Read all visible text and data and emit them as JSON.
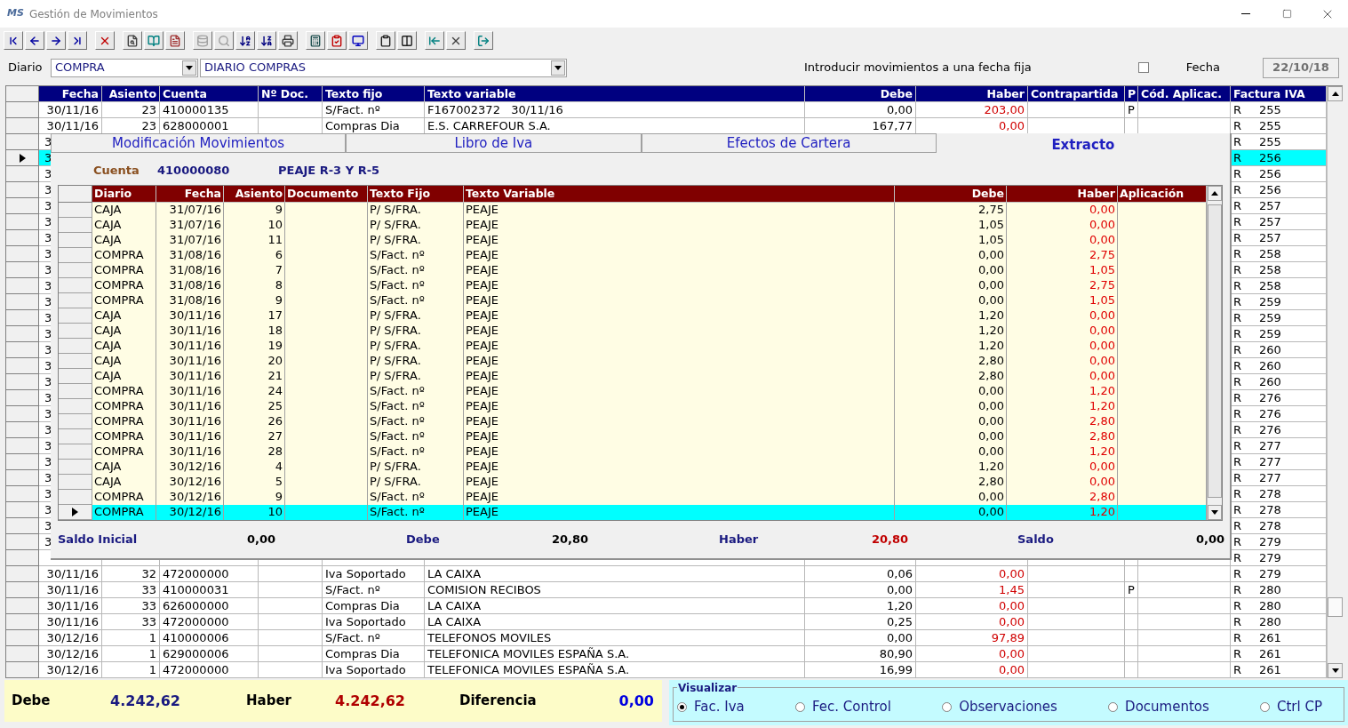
{
  "window": {
    "title": "Gestión de Movimientos",
    "logo": "MS"
  },
  "diario": {
    "label": "Diario",
    "code": "COMPRA",
    "name": "DIARIO COMPRAS"
  },
  "fixed_date": {
    "label": "Introducir movimientos a una fecha fija",
    "checked": false,
    "date_label": "Fecha",
    "date": "22/10/18"
  },
  "table": {
    "columns": [
      "Fecha",
      "Asiento",
      "Cuenta",
      "Nº Doc.",
      "Texto fijo",
      "Texto variable",
      "Debe",
      "Haber",
      "Contrapartida",
      "P",
      "Cód. Aplicac.",
      "Factura IVA"
    ],
    "rows": [
      {
        "selected": false,
        "fecha": "30/11/16",
        "asiento": "23",
        "cuenta": "410000135",
        "texto_fijo": "S/Fact. nº",
        "texto_variable": "F167002372   30/11/16",
        "debe": "0,00",
        "haber": "203,00",
        "p": "P",
        "tipo": "R",
        "factura": "255"
      },
      {
        "selected": false,
        "fecha": "30/11/16",
        "asiento": "23",
        "cuenta": "628000001",
        "texto_fijo": "Compras Dia",
        "texto_variable": "E.S. CARREFOUR S.A.",
        "debe": "167,77",
        "haber": "0,00",
        "tipo": "R",
        "factura": "255"
      },
      {
        "selected": false,
        "fecha": "3",
        "tipo": "R",
        "factura": "255"
      },
      {
        "selected": true,
        "fecha": "3",
        "tipo": "R",
        "factura": "256"
      },
      {
        "selected": false,
        "fecha": "3",
        "tipo": "R",
        "factura": "256"
      },
      {
        "selected": false,
        "fecha": "3",
        "tipo": "R",
        "factura": "256"
      },
      {
        "selected": false,
        "fecha": "3",
        "tipo": "R",
        "factura": "257"
      },
      {
        "selected": false,
        "fecha": "3",
        "tipo": "R",
        "factura": "257"
      },
      {
        "selected": false,
        "fecha": "3",
        "tipo": "R",
        "factura": "257"
      },
      {
        "selected": false,
        "fecha": "3",
        "tipo": "R",
        "factura": "258"
      },
      {
        "selected": false,
        "fecha": "3",
        "tipo": "R",
        "factura": "258"
      },
      {
        "selected": false,
        "fecha": "3",
        "tipo": "R",
        "factura": "258"
      },
      {
        "selected": false,
        "fecha": "3",
        "tipo": "R",
        "factura": "259"
      },
      {
        "selected": false,
        "fecha": "3",
        "tipo": "R",
        "factura": "259"
      },
      {
        "selected": false,
        "fecha": "3",
        "tipo": "R",
        "factura": "259"
      },
      {
        "selected": false,
        "fecha": "3",
        "tipo": "R",
        "factura": "260"
      },
      {
        "selected": false,
        "fecha": "3",
        "tipo": "R",
        "factura": "260"
      },
      {
        "selected": false,
        "fecha": "3",
        "tipo": "R",
        "factura": "260"
      },
      {
        "selected": false,
        "fecha": "3",
        "tipo": "R",
        "factura": "276"
      },
      {
        "selected": false,
        "fecha": "3",
        "tipo": "R",
        "factura": "276"
      },
      {
        "selected": false,
        "fecha": "3",
        "tipo": "R",
        "factura": "276"
      },
      {
        "selected": false,
        "fecha": "3",
        "tipo": "R",
        "factura": "277"
      },
      {
        "selected": false,
        "fecha": "3",
        "tipo": "R",
        "factura": "277"
      },
      {
        "selected": false,
        "fecha": "3",
        "tipo": "R",
        "factura": "277"
      },
      {
        "selected": false,
        "fecha": "3",
        "tipo": "R",
        "factura": "278"
      },
      {
        "selected": false,
        "fecha": "3",
        "tipo": "R",
        "factura": "278"
      },
      {
        "selected": false,
        "fecha": "3",
        "tipo": "R",
        "factura": "278"
      },
      {
        "selected": false,
        "fecha": "3",
        "tipo": "R",
        "factura": "279"
      },
      {
        "selected": false,
        "tipo": "R",
        "factura": "279"
      },
      {
        "selected": false,
        "fecha": "30/11/16",
        "asiento": "32",
        "cuenta": "472000000",
        "texto_fijo": "Iva Soportado",
        "texto_variable": "LA CAIXA",
        "debe": "0,06",
        "haber": "0,00",
        "tipo": "R",
        "factura": "279"
      },
      {
        "selected": false,
        "fecha": "30/11/16",
        "asiento": "33",
        "cuenta": "410000031",
        "texto_fijo": "S/Fact. nº",
        "texto_variable": "COMISION RECIBOS",
        "debe": "0,00",
        "haber": "1,45",
        "p": "P",
        "tipo": "R",
        "factura": "280"
      },
      {
        "selected": false,
        "fecha": "30/11/16",
        "asiento": "33",
        "cuenta": "626000000",
        "texto_fijo": "Compras Dia",
        "texto_variable": "LA CAIXA",
        "debe": "1,20",
        "haber": "0,00",
        "tipo": "R",
        "factura": "280"
      },
      {
        "selected": false,
        "fecha": "30/11/16",
        "asiento": "33",
        "cuenta": "472000000",
        "texto_fijo": "Iva Soportado",
        "texto_variable": "LA CAIXA",
        "debe": "0,25",
        "haber": "0,00",
        "tipo": "R",
        "factura": "280"
      },
      {
        "selected": false,
        "fecha": "30/12/16",
        "asiento": "1",
        "cuenta": "410000006",
        "texto_fijo": "S/Fact. nº",
        "texto_variable": "TELEFONOS MOVILES",
        "debe": "0,00",
        "haber": "97,89",
        "tipo": "R",
        "factura": "261"
      },
      {
        "selected": false,
        "fecha": "30/12/16",
        "asiento": "1",
        "cuenta": "629000006",
        "texto_fijo": "Compras Dia",
        "texto_variable": "TELEFONICA MOVILES ESPAÑA S.A.",
        "debe": "80,90",
        "haber": "0,00",
        "tipo": "R",
        "factura": "261"
      },
      {
        "selected": false,
        "fecha": "30/12/16",
        "asiento": "1",
        "cuenta": "472000000",
        "texto_fijo": "Iva Soportado",
        "texto_variable": "TELEFONICA MOVILES ESPAÑA S.A.",
        "debe": "16,99",
        "haber": "0,00",
        "tipo": "R",
        "factura": "261"
      }
    ]
  },
  "popup": {
    "tabs": [
      {
        "label": "Modificación Movimientos",
        "selected": false
      },
      {
        "label": "Libro de Iva",
        "selected": false
      },
      {
        "label": "Efectos de Cartera",
        "selected": false
      },
      {
        "label": "Extracto",
        "selected": true
      }
    ],
    "account": {
      "label": "Cuenta",
      "number": "410000080",
      "name": "PEAJE R-3 Y R-5"
    },
    "extract": {
      "columns": [
        "Diario",
        "Fecha",
        "Asiento",
        "Documento",
        "Texto Fijo",
        "Texto Variable",
        "Debe",
        "Haber",
        "Aplicación"
      ],
      "rows": [
        {
          "selected": false,
          "diario": "CAJA",
          "fecha": "31/07/16",
          "asiento": "9",
          "texto_fijo": "P/ S/FRA.",
          "texto_variable": "PEAJE",
          "debe": "2,75",
          "haber": "0,00"
        },
        {
          "selected": false,
          "diario": "CAJA",
          "fecha": "31/07/16",
          "asiento": "10",
          "texto_fijo": "P/ S/FRA.",
          "texto_variable": "PEAJE",
          "debe": "1,05",
          "haber": "0,00"
        },
        {
          "selected": false,
          "diario": "CAJA",
          "fecha": "31/07/16",
          "asiento": "11",
          "texto_fijo": "P/ S/FRA.",
          "texto_variable": "PEAJE",
          "debe": "1,05",
          "haber": "0,00"
        },
        {
          "selected": false,
          "diario": "COMPRA",
          "fecha": "31/08/16",
          "asiento": "6",
          "texto_fijo": "S/Fact. nº",
          "texto_variable": "PEAJE",
          "debe": "0,00",
          "haber": "2,75"
        },
        {
          "selected": false,
          "diario": "COMPRA",
          "fecha": "31/08/16",
          "asiento": "7",
          "texto_fijo": "S/Fact. nº",
          "texto_variable": "PEAJE",
          "debe": "0,00",
          "haber": "1,05"
        },
        {
          "selected": false,
          "diario": "COMPRA",
          "fecha": "31/08/16",
          "asiento": "8",
          "texto_fijo": "S/Fact. nº",
          "texto_variable": "PEAJE",
          "debe": "0,00",
          "haber": "2,75"
        },
        {
          "selected": false,
          "diario": "COMPRA",
          "fecha": "31/08/16",
          "asiento": "9",
          "texto_fijo": "S/Fact. nº",
          "texto_variable": "PEAJE",
          "debe": "0,00",
          "haber": "1,05"
        },
        {
          "selected": false,
          "diario": "CAJA",
          "fecha": "30/11/16",
          "asiento": "17",
          "texto_fijo": "P/ S/FRA.",
          "texto_variable": "PEAJE",
          "debe": "1,20",
          "haber": "0,00"
        },
        {
          "selected": false,
          "diario": "CAJA",
          "fecha": "30/11/16",
          "asiento": "18",
          "texto_fijo": "P/ S/FRA.",
          "texto_variable": "PEAJE",
          "debe": "1,20",
          "haber": "0,00"
        },
        {
          "selected": false,
          "diario": "CAJA",
          "fecha": "30/11/16",
          "asiento": "19",
          "texto_fijo": "P/ S/FRA.",
          "texto_variable": "PEAJE",
          "debe": "1,20",
          "haber": "0,00"
        },
        {
          "selected": false,
          "diario": "CAJA",
          "fecha": "30/11/16",
          "asiento": "20",
          "texto_fijo": "P/ S/FRA.",
          "texto_variable": "PEAJE",
          "debe": "2,80",
          "haber": "0,00"
        },
        {
          "selected": false,
          "diario": "CAJA",
          "fecha": "30/11/16",
          "asiento": "21",
          "texto_fijo": "P/ S/FRA.",
          "texto_variable": "PEAJE",
          "debe": "2,80",
          "haber": "0,00"
        },
        {
          "selected": false,
          "diario": "COMPRA",
          "fecha": "30/11/16",
          "asiento": "24",
          "texto_fijo": "S/Fact. nº",
          "texto_variable": "PEAJE",
          "debe": "0,00",
          "haber": "1,20"
        },
        {
          "selected": false,
          "diario": "COMPRA",
          "fecha": "30/11/16",
          "asiento": "25",
          "texto_fijo": "S/Fact. nº",
          "texto_variable": "PEAJE",
          "debe": "0,00",
          "haber": "1,20"
        },
        {
          "selected": false,
          "diario": "COMPRA",
          "fecha": "30/11/16",
          "asiento": "26",
          "texto_fijo": "S/Fact. nº",
          "texto_variable": "PEAJE",
          "debe": "0,00",
          "haber": "2,80"
        },
        {
          "selected": false,
          "diario": "COMPRA",
          "fecha": "30/11/16",
          "asiento": "27",
          "texto_fijo": "S/Fact. nº",
          "texto_variable": "PEAJE",
          "debe": "0,00",
          "haber": "2,80"
        },
        {
          "selected": false,
          "diario": "COMPRA",
          "fecha": "30/11/16",
          "asiento": "28",
          "texto_fijo": "S/Fact. nº",
          "texto_variable": "PEAJE",
          "debe": "0,00",
          "haber": "1,20"
        },
        {
          "selected": false,
          "diario": "CAJA",
          "fecha": "30/12/16",
          "asiento": "4",
          "texto_fijo": "P/ S/FRA.",
          "texto_variable": "PEAJE",
          "debe": "1,20",
          "haber": "0,00"
        },
        {
          "selected": false,
          "diario": "CAJA",
          "fecha": "30/12/16",
          "asiento": "5",
          "texto_fijo": "P/ S/FRA.",
          "texto_variable": "PEAJE",
          "debe": "2,80",
          "haber": "0,00"
        },
        {
          "selected": false,
          "diario": "COMPRA",
          "fecha": "30/12/16",
          "asiento": "9",
          "texto_fijo": "S/Fact. nº",
          "texto_variable": "PEAJE",
          "debe": "0,00",
          "haber": "2,80"
        },
        {
          "selected": true,
          "diario": "COMPRA",
          "fecha": "30/12/16",
          "asiento": "10",
          "texto_fijo": "S/Fact. nº",
          "texto_variable": "PEAJE",
          "debe": "0,00",
          "haber": "1,20"
        }
      ]
    },
    "totals": [
      {
        "label": "Saldo Inicial",
        "value": "0,00",
        "color": "#000000"
      },
      {
        "label": "Debe",
        "value": "20,80",
        "color": "#000000"
      },
      {
        "label": "Haber",
        "value": "20,80",
        "color": "#c00000"
      },
      {
        "label": "Saldo",
        "value": "0,00",
        "color": "#000000"
      }
    ]
  },
  "totals": [
    {
      "label": "Debe",
      "value": "4.242,62",
      "color": "#1a1a80"
    },
    {
      "label": "Haber",
      "value": "4.242,62",
      "color": "#b00000"
    },
    {
      "label": "Diferencia",
      "value": "0,00",
      "color": "#0000e0"
    }
  ],
  "visualizar": {
    "title": "Visualizar",
    "options": [
      {
        "label": "Fac. Iva",
        "selected": true
      },
      {
        "label": "Fec. Control",
        "selected": false
      },
      {
        "label": "Observaciones",
        "selected": false
      },
      {
        "label": "Documentos",
        "selected": false
      },
      {
        "label": "Ctrl CP",
        "selected": false
      }
    ]
  }
}
